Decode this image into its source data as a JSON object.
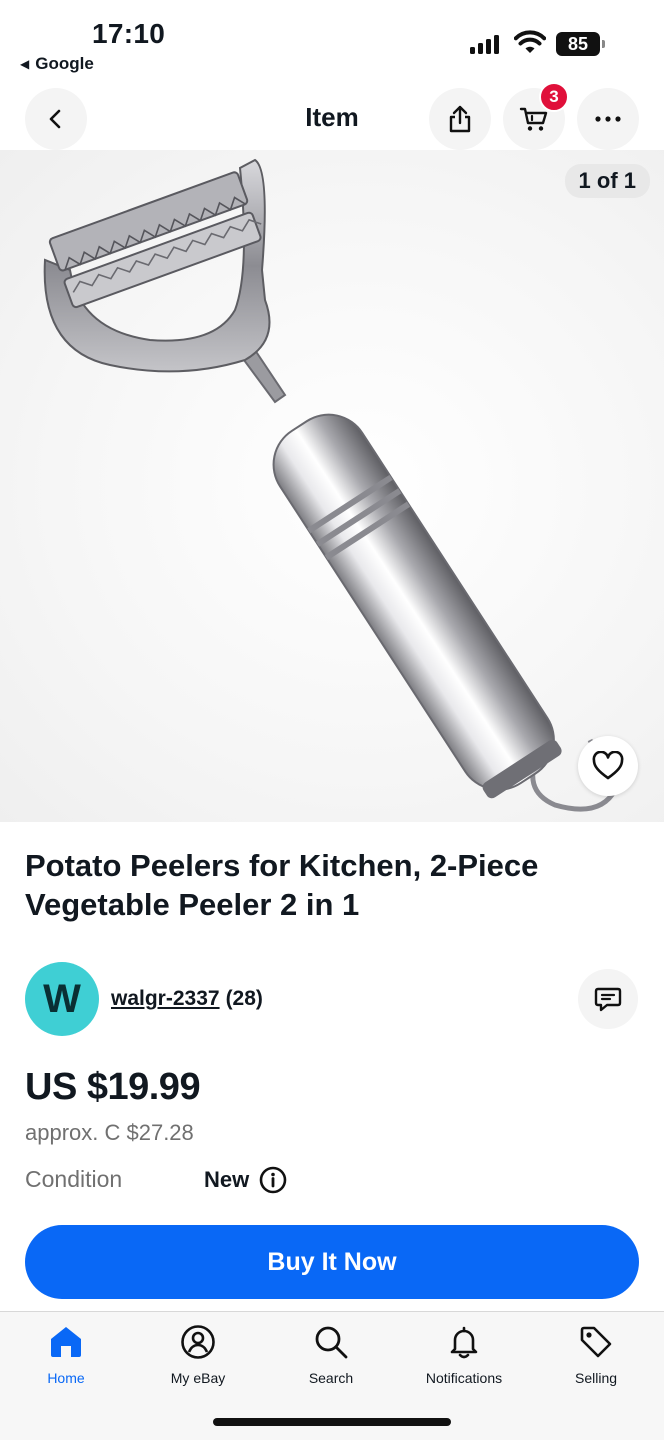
{
  "status_bar": {
    "time": "17:10",
    "back_app": "Google",
    "battery": "85"
  },
  "nav": {
    "title": "Item",
    "cart_count": "3"
  },
  "gallery": {
    "counter": "1 of 1"
  },
  "item": {
    "title": "Potato Peelers for Kitchen, 2-Piece Vegetable Peeler 2 in 1"
  },
  "seller": {
    "avatar_letter": "W",
    "name": "walgr-2337",
    "score": "(28)"
  },
  "pricing": {
    "price": "US $19.99",
    "approx": "approx. C $27.28",
    "condition_label": "Condition",
    "condition_value": "New"
  },
  "actions": {
    "buy_now": "Buy It Now"
  },
  "tab_bar": {
    "items": [
      {
        "label": "Home",
        "icon": "home-icon",
        "active": true
      },
      {
        "label": "My eBay",
        "icon": "profile-icon"
      },
      {
        "label": "Search",
        "icon": "search-icon"
      },
      {
        "label": "Notifications",
        "icon": "bell-icon"
      },
      {
        "label": "Selling",
        "icon": "tag-icon"
      }
    ]
  },
  "colors": {
    "accent": "#0968f6",
    "badge": "#e0103a",
    "avatar": "#3fcfd4"
  }
}
